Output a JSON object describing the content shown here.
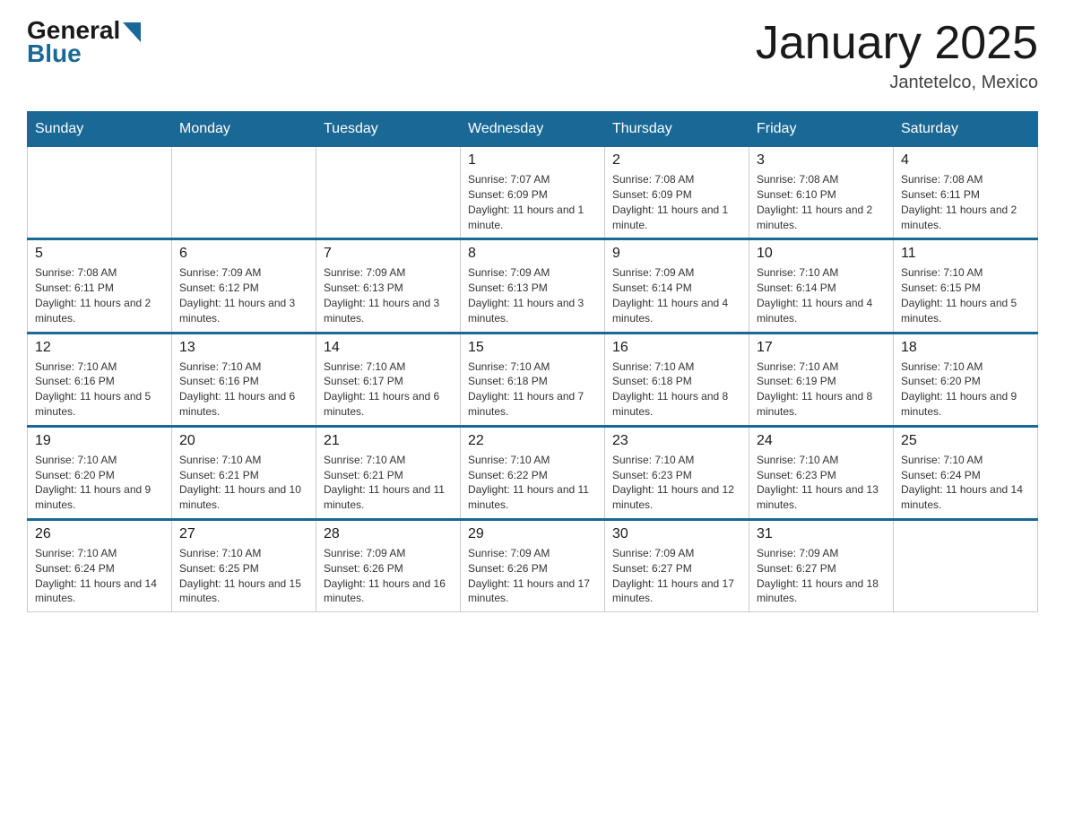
{
  "logo": {
    "general": "General",
    "blue": "Blue",
    "arrow_color": "#1a6896"
  },
  "header": {
    "month_year": "January 2025",
    "location": "Jantetelco, Mexico"
  },
  "days_of_week": [
    "Sunday",
    "Monday",
    "Tuesday",
    "Wednesday",
    "Thursday",
    "Friday",
    "Saturday"
  ],
  "weeks": [
    [
      {
        "day": "",
        "info": ""
      },
      {
        "day": "",
        "info": ""
      },
      {
        "day": "",
        "info": ""
      },
      {
        "day": "1",
        "info": "Sunrise: 7:07 AM\nSunset: 6:09 PM\nDaylight: 11 hours and 1 minute."
      },
      {
        "day": "2",
        "info": "Sunrise: 7:08 AM\nSunset: 6:09 PM\nDaylight: 11 hours and 1 minute."
      },
      {
        "day": "3",
        "info": "Sunrise: 7:08 AM\nSunset: 6:10 PM\nDaylight: 11 hours and 2 minutes."
      },
      {
        "day": "4",
        "info": "Sunrise: 7:08 AM\nSunset: 6:11 PM\nDaylight: 11 hours and 2 minutes."
      }
    ],
    [
      {
        "day": "5",
        "info": "Sunrise: 7:08 AM\nSunset: 6:11 PM\nDaylight: 11 hours and 2 minutes."
      },
      {
        "day": "6",
        "info": "Sunrise: 7:09 AM\nSunset: 6:12 PM\nDaylight: 11 hours and 3 minutes."
      },
      {
        "day": "7",
        "info": "Sunrise: 7:09 AM\nSunset: 6:13 PM\nDaylight: 11 hours and 3 minutes."
      },
      {
        "day": "8",
        "info": "Sunrise: 7:09 AM\nSunset: 6:13 PM\nDaylight: 11 hours and 3 minutes."
      },
      {
        "day": "9",
        "info": "Sunrise: 7:09 AM\nSunset: 6:14 PM\nDaylight: 11 hours and 4 minutes."
      },
      {
        "day": "10",
        "info": "Sunrise: 7:10 AM\nSunset: 6:14 PM\nDaylight: 11 hours and 4 minutes."
      },
      {
        "day": "11",
        "info": "Sunrise: 7:10 AM\nSunset: 6:15 PM\nDaylight: 11 hours and 5 minutes."
      }
    ],
    [
      {
        "day": "12",
        "info": "Sunrise: 7:10 AM\nSunset: 6:16 PM\nDaylight: 11 hours and 5 minutes."
      },
      {
        "day": "13",
        "info": "Sunrise: 7:10 AM\nSunset: 6:16 PM\nDaylight: 11 hours and 6 minutes."
      },
      {
        "day": "14",
        "info": "Sunrise: 7:10 AM\nSunset: 6:17 PM\nDaylight: 11 hours and 6 minutes."
      },
      {
        "day": "15",
        "info": "Sunrise: 7:10 AM\nSunset: 6:18 PM\nDaylight: 11 hours and 7 minutes."
      },
      {
        "day": "16",
        "info": "Sunrise: 7:10 AM\nSunset: 6:18 PM\nDaylight: 11 hours and 8 minutes."
      },
      {
        "day": "17",
        "info": "Sunrise: 7:10 AM\nSunset: 6:19 PM\nDaylight: 11 hours and 8 minutes."
      },
      {
        "day": "18",
        "info": "Sunrise: 7:10 AM\nSunset: 6:20 PM\nDaylight: 11 hours and 9 minutes."
      }
    ],
    [
      {
        "day": "19",
        "info": "Sunrise: 7:10 AM\nSunset: 6:20 PM\nDaylight: 11 hours and 9 minutes."
      },
      {
        "day": "20",
        "info": "Sunrise: 7:10 AM\nSunset: 6:21 PM\nDaylight: 11 hours and 10 minutes."
      },
      {
        "day": "21",
        "info": "Sunrise: 7:10 AM\nSunset: 6:21 PM\nDaylight: 11 hours and 11 minutes."
      },
      {
        "day": "22",
        "info": "Sunrise: 7:10 AM\nSunset: 6:22 PM\nDaylight: 11 hours and 11 minutes."
      },
      {
        "day": "23",
        "info": "Sunrise: 7:10 AM\nSunset: 6:23 PM\nDaylight: 11 hours and 12 minutes."
      },
      {
        "day": "24",
        "info": "Sunrise: 7:10 AM\nSunset: 6:23 PM\nDaylight: 11 hours and 13 minutes."
      },
      {
        "day": "25",
        "info": "Sunrise: 7:10 AM\nSunset: 6:24 PM\nDaylight: 11 hours and 14 minutes."
      }
    ],
    [
      {
        "day": "26",
        "info": "Sunrise: 7:10 AM\nSunset: 6:24 PM\nDaylight: 11 hours and 14 minutes."
      },
      {
        "day": "27",
        "info": "Sunrise: 7:10 AM\nSunset: 6:25 PM\nDaylight: 11 hours and 15 minutes."
      },
      {
        "day": "28",
        "info": "Sunrise: 7:09 AM\nSunset: 6:26 PM\nDaylight: 11 hours and 16 minutes."
      },
      {
        "day": "29",
        "info": "Sunrise: 7:09 AM\nSunset: 6:26 PM\nDaylight: 11 hours and 17 minutes."
      },
      {
        "day": "30",
        "info": "Sunrise: 7:09 AM\nSunset: 6:27 PM\nDaylight: 11 hours and 17 minutes."
      },
      {
        "day": "31",
        "info": "Sunrise: 7:09 AM\nSunset: 6:27 PM\nDaylight: 11 hours and 18 minutes."
      },
      {
        "day": "",
        "info": ""
      }
    ]
  ]
}
